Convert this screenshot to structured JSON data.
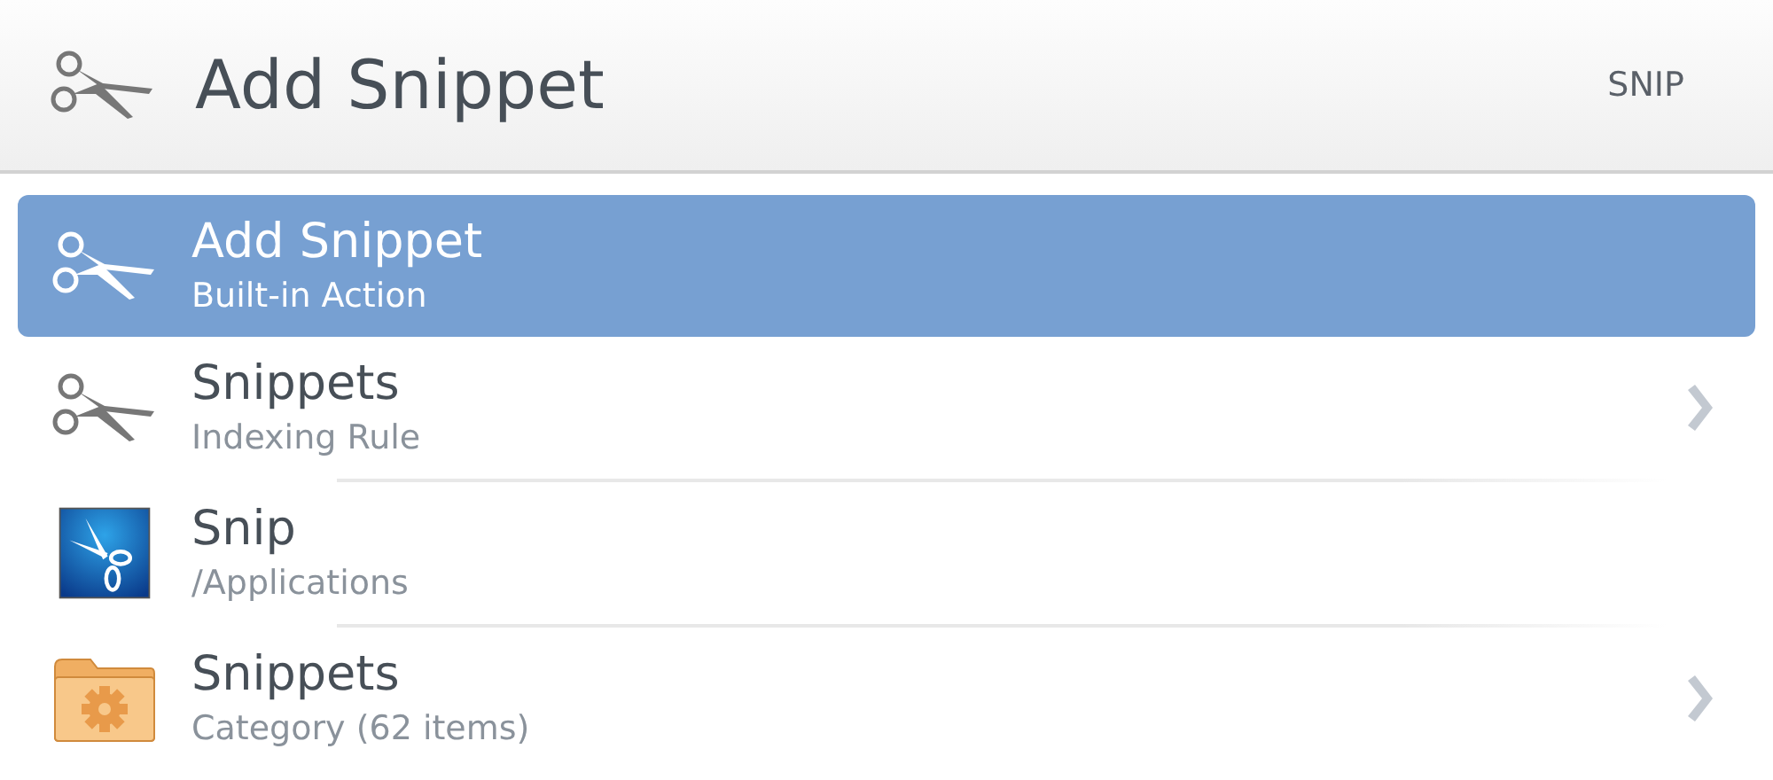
{
  "header": {
    "title": "Add Snippet",
    "query": "SNIP"
  },
  "results": [
    {
      "kind": "scissors",
      "title": "Add Snippet",
      "subtitle": "Built-in Action",
      "selected": true,
      "has_children": false
    },
    {
      "kind": "scissors",
      "title": "Snippets",
      "subtitle": "Indexing Rule",
      "selected": false,
      "has_children": true
    },
    {
      "kind": "app",
      "title": "Snip",
      "subtitle": "/Applications",
      "selected": false,
      "has_children": false
    },
    {
      "kind": "folder",
      "title": "Snippets",
      "subtitle": "Category (62 items)",
      "selected": false,
      "has_children": true
    }
  ]
}
